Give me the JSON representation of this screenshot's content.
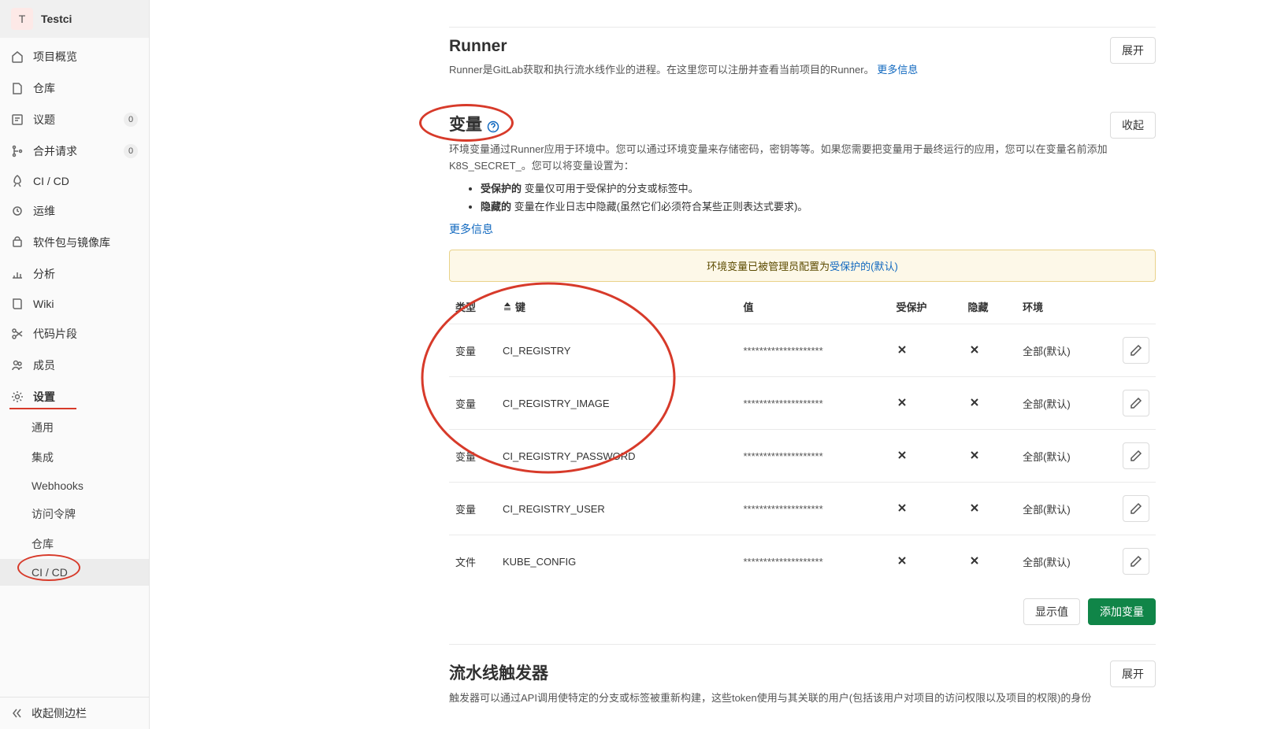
{
  "project": {
    "initial": "T",
    "name": "Testci"
  },
  "sidebar": {
    "items": [
      {
        "label": "项目概览",
        "icon": "home"
      },
      {
        "label": "仓库",
        "icon": "doc"
      },
      {
        "label": "议题",
        "icon": "issue",
        "badge": "0"
      },
      {
        "label": "合并请求",
        "icon": "merge",
        "badge": "0"
      },
      {
        "label": "CI / CD",
        "icon": "rocket"
      },
      {
        "label": "运维",
        "icon": "ops"
      },
      {
        "label": "软件包与镜像库",
        "icon": "package"
      },
      {
        "label": "分析",
        "icon": "chart"
      },
      {
        "label": "Wiki",
        "icon": "book"
      },
      {
        "label": "代码片段",
        "icon": "scissors"
      },
      {
        "label": "成员",
        "icon": "members"
      }
    ],
    "settings_label": "设置",
    "subitems": [
      {
        "label": "通用"
      },
      {
        "label": "集成"
      },
      {
        "label": "Webhooks"
      },
      {
        "label": "访问令牌"
      },
      {
        "label": "仓库"
      },
      {
        "label": "CI / CD"
      }
    ],
    "collapse_label": "收起侧边栏"
  },
  "runner": {
    "title": "Runner",
    "desc": "Runner是GitLab获取和执行流水线作业的进程。在这里您可以注册并查看当前项目的Runner。",
    "more_link": "更多信息",
    "expand_btn": "展开"
  },
  "variables": {
    "title": "变量",
    "desc_part1": "环境变量通过Runner应用于环境中。您可以通过环境变量来存储密码，密钥等等。如果您需要把变量用于最终运行的应用，您可以在变量名前添加 ",
    "prefix": "K8S_SECRET_",
    "desc_part2": "。您可以将变量设置为：",
    "bullet_protected_label": "受保护的",
    "bullet_protected_text": " 变量仅可用于受保护的分支或标签中。",
    "bullet_hidden_label": "隐藏的",
    "bullet_hidden_text": " 变量在作业日志中隐藏(虽然它们必须符合某些正则表达式要求)。",
    "more_link": "更多信息",
    "collapse_btn": "收起",
    "alert_prefix": "环境变量已被管理员配置为",
    "alert_link": "受保护的(默认)",
    "headers": {
      "type": "类型",
      "key": "键",
      "value": "值",
      "protected": "受保护",
      "hidden": "隐藏",
      "env": "环境"
    },
    "rows": [
      {
        "type": "变量",
        "key": "CI_REGISTRY",
        "value": "********************",
        "env": "全部(默认)"
      },
      {
        "type": "变量",
        "key": "CI_REGISTRY_IMAGE",
        "value": "********************",
        "env": "全部(默认)"
      },
      {
        "type": "变量",
        "key": "CI_REGISTRY_PASSWORD",
        "value": "********************",
        "env": "全部(默认)"
      },
      {
        "type": "变量",
        "key": "CI_REGISTRY_USER",
        "value": "********************",
        "env": "全部(默认)"
      },
      {
        "type": "文件",
        "key": "KUBE_CONFIG",
        "value": "********************",
        "env": "全部(默认)"
      }
    ],
    "show_values_btn": "显示值",
    "add_var_btn": "添加变量"
  },
  "triggers": {
    "title": "流水线触发器",
    "desc": "触发器可以通过API调用使特定的分支或标签被重新构建，这些token使用与其关联的用户(包括该用户对项目的访问权限以及项目的权限)的身份",
    "expand_btn": "展开"
  }
}
